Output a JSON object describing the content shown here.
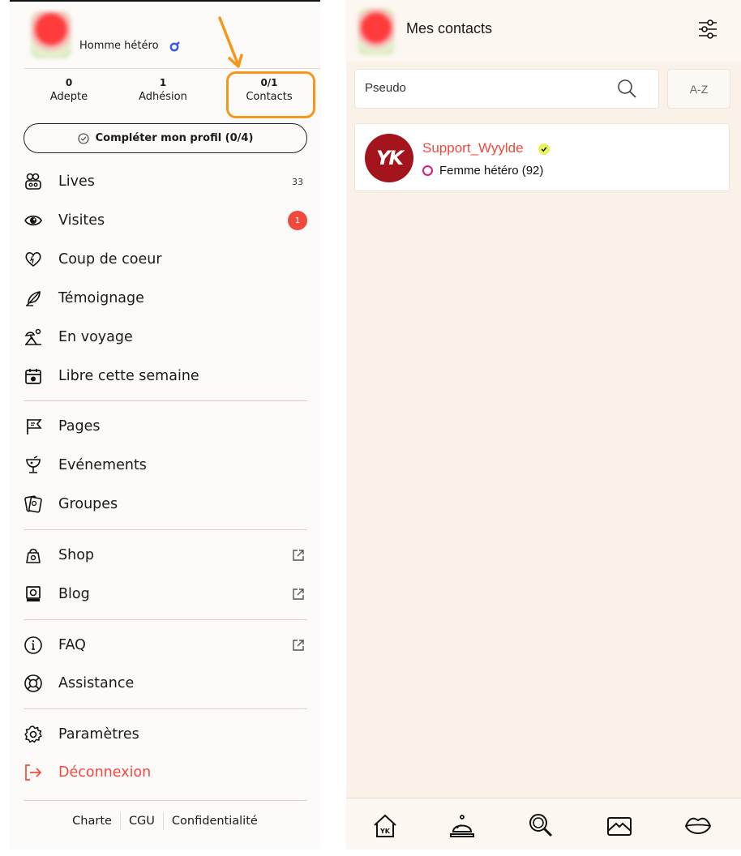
{
  "sidebar": {
    "profile": {
      "orientation": "Homme hétéro"
    },
    "stats": [
      {
        "value": "0",
        "label": "Adepte"
      },
      {
        "value": "1",
        "label": "Adhésion"
      },
      {
        "value": "0/1",
        "label": "Contacts"
      }
    ],
    "complete_profile": "Compléter mon profil (0/4)",
    "menu": [
      {
        "label": "Lives",
        "icon": "lives-icon",
        "count": "33"
      },
      {
        "label": "Visites",
        "icon": "eye-icon",
        "badge": "1"
      },
      {
        "label": "Coup de coeur",
        "icon": "heart-icon"
      },
      {
        "label": "Témoignage",
        "icon": "feather-icon"
      },
      {
        "label": "En voyage",
        "icon": "beach-icon"
      },
      {
        "label": "Libre cette semaine",
        "icon": "calendar-icon"
      },
      {
        "label": "Pages",
        "icon": "flag-icon"
      },
      {
        "label": "Evénements",
        "icon": "cocktail-icon"
      },
      {
        "label": "Groupes",
        "icon": "cards-icon"
      },
      {
        "label": "Shop",
        "icon": "shop-bag-icon"
      },
      {
        "label": "Blog",
        "icon": "blog-icon"
      },
      {
        "label": "FAQ",
        "icon": "info-icon"
      },
      {
        "label": "Assistance",
        "icon": "lifebuoy-icon"
      },
      {
        "label": "Paramètres",
        "icon": "gear-icon"
      },
      {
        "label": "Déconnexion",
        "icon": "logout-icon"
      }
    ],
    "footer": [
      "Charte",
      "CGU",
      "Confidentialité"
    ]
  },
  "main": {
    "title": "Mes contacts",
    "search": {
      "placeholder": "Pseudo"
    },
    "sort_label": "A-Z",
    "contacts": [
      {
        "name": "Support_Wyylde",
        "avatar_text": "YK",
        "orientation": "Femme hétéro (92)"
      }
    ],
    "bottom_nav": [
      "home-icon",
      "bell-icon",
      "search-icon",
      "mail-icon",
      "lips-icon"
    ]
  },
  "colors": {
    "accent": "#f04a3f",
    "highlight": "#f5961d",
    "avatar": "#a4141c",
    "pink_ring": "#e0197d"
  }
}
